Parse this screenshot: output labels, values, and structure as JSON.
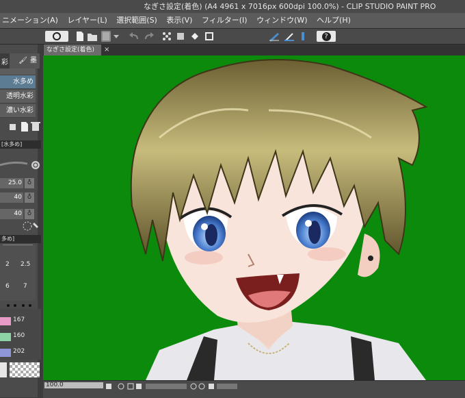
{
  "window": {
    "title": "なぎさ設定(着色) (A4 4961 x 7016px 600dpi 100.0%)  -  CLIP STUDIO PAINT PRO"
  },
  "menu": [
    "ニメーション(A)",
    "レイヤー(L)",
    "選択範囲(S)",
    "表示(V)",
    "フィルター(I)",
    "ウィンドウ(W)",
    "ヘルプ(H)"
  ],
  "toolbar": {
    "help_label": "?"
  },
  "document_tab": {
    "label": "なぎさ設定(着色)",
    "close": "×"
  },
  "tool_panel": {
    "tabs": [
      "彩",
      "墨"
    ],
    "subtools": [
      "水多め",
      "透明水彩",
      "濃い水彩"
    ],
    "selected_subtool": "水多め",
    "property_title": "[水多め]",
    "brush_size": "25.0",
    "paint_amount": "40",
    "paint_density": "40"
  },
  "brush_size_panel": {
    "title": "多め]",
    "sizes": [
      "2",
      "2.5",
      "6",
      "7"
    ]
  },
  "color_sliders": [
    {
      "value": "167",
      "color": "#e79ac5"
    },
    {
      "value": "160",
      "color": "#8ed3a5"
    },
    {
      "value": "202",
      "color": "#8e96d8"
    }
  ],
  "status": {
    "zoom": "100.0"
  }
}
